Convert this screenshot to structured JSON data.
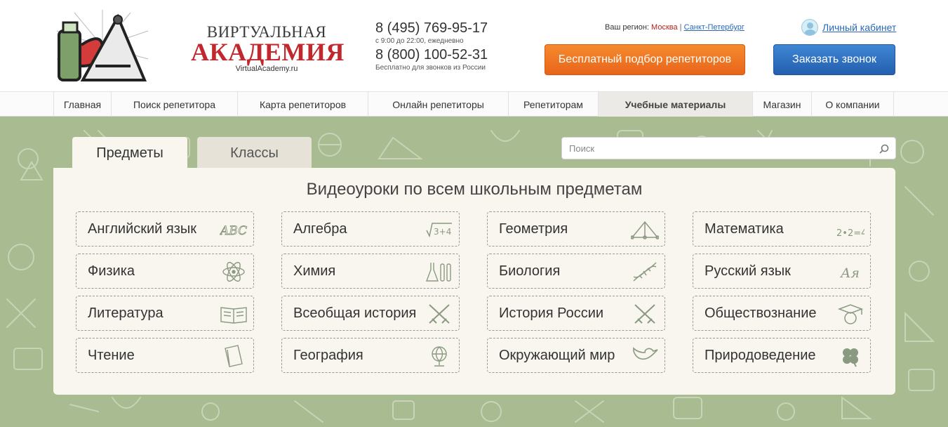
{
  "header": {
    "logo_top": "ВИРТУАЛЬНАЯ",
    "logo_main": "АКАДЕМИЯ",
    "logo_url": "VirtualAcademy.ru",
    "phone1": "8 (495) 769-95-17",
    "phone1_note": "с 9:00 до 22:00, ежедневно",
    "phone2": "8 (800) 100-52-31",
    "phone2_note": "Бесплатно для звонков из России",
    "region_label": "Ваш регион:",
    "region_current": "Москва",
    "region_sep": "|",
    "region_other": "Санкт-Петербург",
    "account_label": "Личный кабинет",
    "tutor_button": "Бесплатный подбор репетиторов",
    "call_button": "Заказать звонок"
  },
  "nav": {
    "items": [
      {
        "label": "Главная"
      },
      {
        "label": "Поиск репетитора"
      },
      {
        "label": "Карта репетиторов"
      },
      {
        "label": "Онлайн репетиторы"
      },
      {
        "label": "Репетиторам"
      },
      {
        "label": "Учебные материалы",
        "active": true
      },
      {
        "label": "Магазин"
      },
      {
        "label": "О компании"
      }
    ]
  },
  "tabs": {
    "subjects": "Предметы",
    "classes": "Классы"
  },
  "search": {
    "placeholder": "Поиск"
  },
  "panel": {
    "title": "Видеоуроки по всем школьным предметам",
    "subjects": [
      {
        "label": "Английский язык",
        "icon": "abc-icon"
      },
      {
        "label": "Алгебра",
        "icon": "sqrt-icon"
      },
      {
        "label": "Геометрия",
        "icon": "triangle-icon"
      },
      {
        "label": "Математика",
        "icon": "equation-icon"
      },
      {
        "label": "Физика",
        "icon": "atom-icon"
      },
      {
        "label": "Химия",
        "icon": "flasks-icon"
      },
      {
        "label": "Биология",
        "icon": "dna-icon"
      },
      {
        "label": "Русский язык",
        "icon": "letters-icon"
      },
      {
        "label": "Литература",
        "icon": "book-icon"
      },
      {
        "label": "Всеобщая история",
        "icon": "swords-icon"
      },
      {
        "label": "История России",
        "icon": "swords-icon"
      },
      {
        "label": "Обществознание",
        "icon": "graduate-icon"
      },
      {
        "label": "Чтение",
        "icon": "books-icon"
      },
      {
        "label": "География",
        "icon": "globe-icon"
      },
      {
        "label": "Окружающий мир",
        "icon": "bird-icon"
      },
      {
        "label": "Природоведение",
        "icon": "clover-icon"
      }
    ]
  },
  "colors": {
    "brand_red": "#c0282d",
    "orange_button": "#f0781f",
    "blue_button": "#2f72c2",
    "background_green": "#a8bb91",
    "panel_bg": "#f9f6ef"
  }
}
